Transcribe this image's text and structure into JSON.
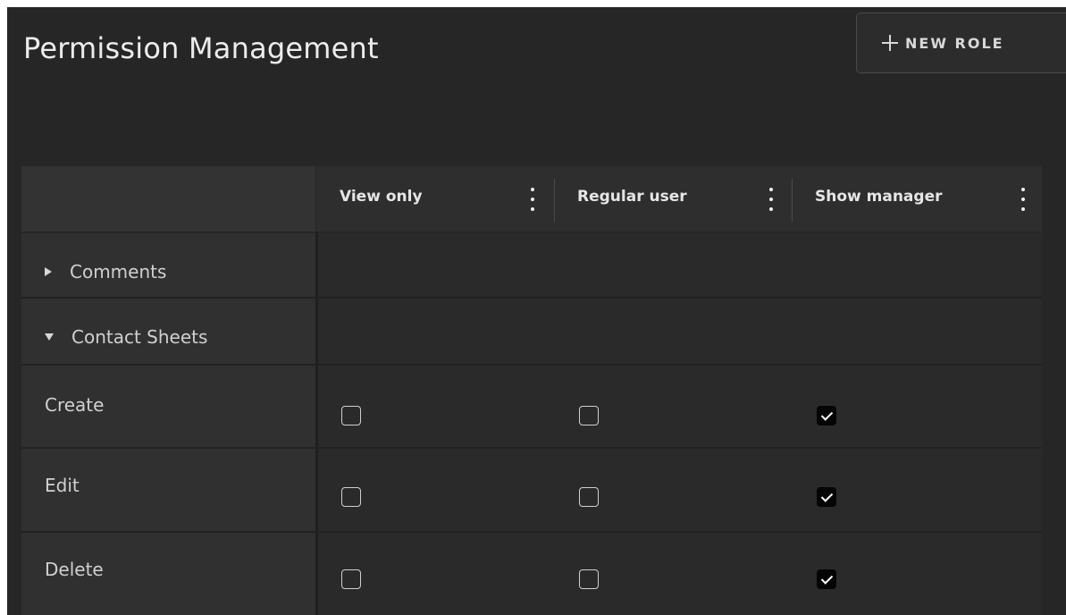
{
  "page": {
    "title": "Permission Management"
  },
  "toolbar": {
    "new_role_label": "NEW ROLE",
    "new_role_icon": "plus-icon"
  },
  "table": {
    "columns": [
      {
        "label": "View only",
        "menu_icon": "kebab-menu-icon"
      },
      {
        "label": "Regular user",
        "menu_icon": "kebab-menu-icon"
      },
      {
        "label": "Show manager",
        "menu_icon": "kebab-menu-icon"
      }
    ],
    "groups": [
      {
        "label": "Comments",
        "expanded": false
      },
      {
        "label": "Contact Sheets",
        "expanded": true
      }
    ],
    "permissions": [
      {
        "label": "Create",
        "values": [
          false,
          false,
          true
        ]
      },
      {
        "label": "Edit",
        "values": [
          false,
          false,
          true
        ]
      },
      {
        "label": "Delete",
        "values": [
          false,
          false,
          true
        ]
      }
    ]
  },
  "colors": {
    "background": "#262626",
    "checked_fill": "#050505",
    "text": "#d0d0d0"
  }
}
